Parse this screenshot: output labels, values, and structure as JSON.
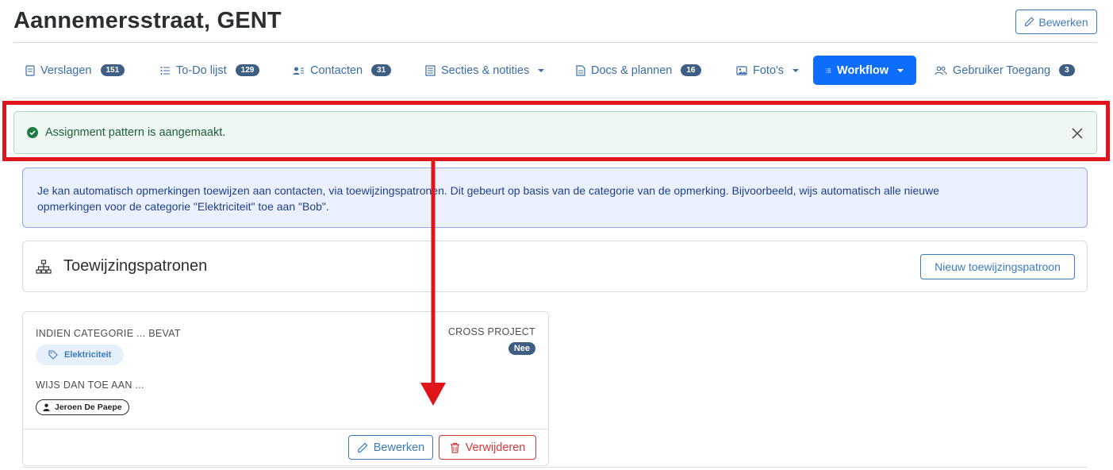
{
  "header": {
    "title": "Aannemersstraat, GENT",
    "edit_label": "Bewerken"
  },
  "tabs": [
    {
      "label": "Verslagen",
      "count": "151",
      "icon": "document-icon"
    },
    {
      "label": "To-Do lijst",
      "count": "129",
      "icon": "list-icon"
    },
    {
      "label": "Contacten",
      "count": "31",
      "icon": "contacts-icon"
    },
    {
      "label": "Secties & notities",
      "icon": "sections-icon",
      "dropdown": true
    },
    {
      "label": "Docs & plannen",
      "count": "16",
      "icon": "file-icon"
    },
    {
      "label": "Foto's",
      "icon": "image-icon",
      "dropdown": true
    },
    {
      "label": "Workflow",
      "icon": "list-check-icon",
      "dropdown": true,
      "active": true
    },
    {
      "label": "Gebruiker Toegang",
      "count": "3",
      "icon": "users-icon"
    }
  ],
  "success_alert": {
    "message": "Assignment pattern is aangemaakt."
  },
  "info_alert": {
    "line1": "Je kan automatisch opmerkingen toewijzen aan contacten, via toewijzingspatronen. Dit gebeurt op basis van de categorie van de opmerking. Bijvoorbeeld, wijs automatisch alle nieuwe",
    "line2": "opmerkingen voor de categorie \"Elektriciteit\" toe aan \"Bob\"."
  },
  "patterns_section": {
    "title": "Toewijzingspatronen",
    "new_button": "Nieuw toewijzingspatroon"
  },
  "pattern_card": {
    "condition_label": "INDIEN CATEGORIE ... BEVAT",
    "category": "Elektriciteit",
    "cross_project_label": "CROSS PROJECT",
    "cross_project_value": "Nee",
    "assign_label": "WIJS DAN TOE AAN ...",
    "assignee": "Jeroen De Paepe",
    "edit_button": "Bewerken",
    "delete_button": "Verwijderen"
  },
  "colors": {
    "primary": "#0d6efd",
    "annotation_red": "#e0151b",
    "success_bg": "#eef7f1",
    "info_bg": "#eaf0fd"
  }
}
